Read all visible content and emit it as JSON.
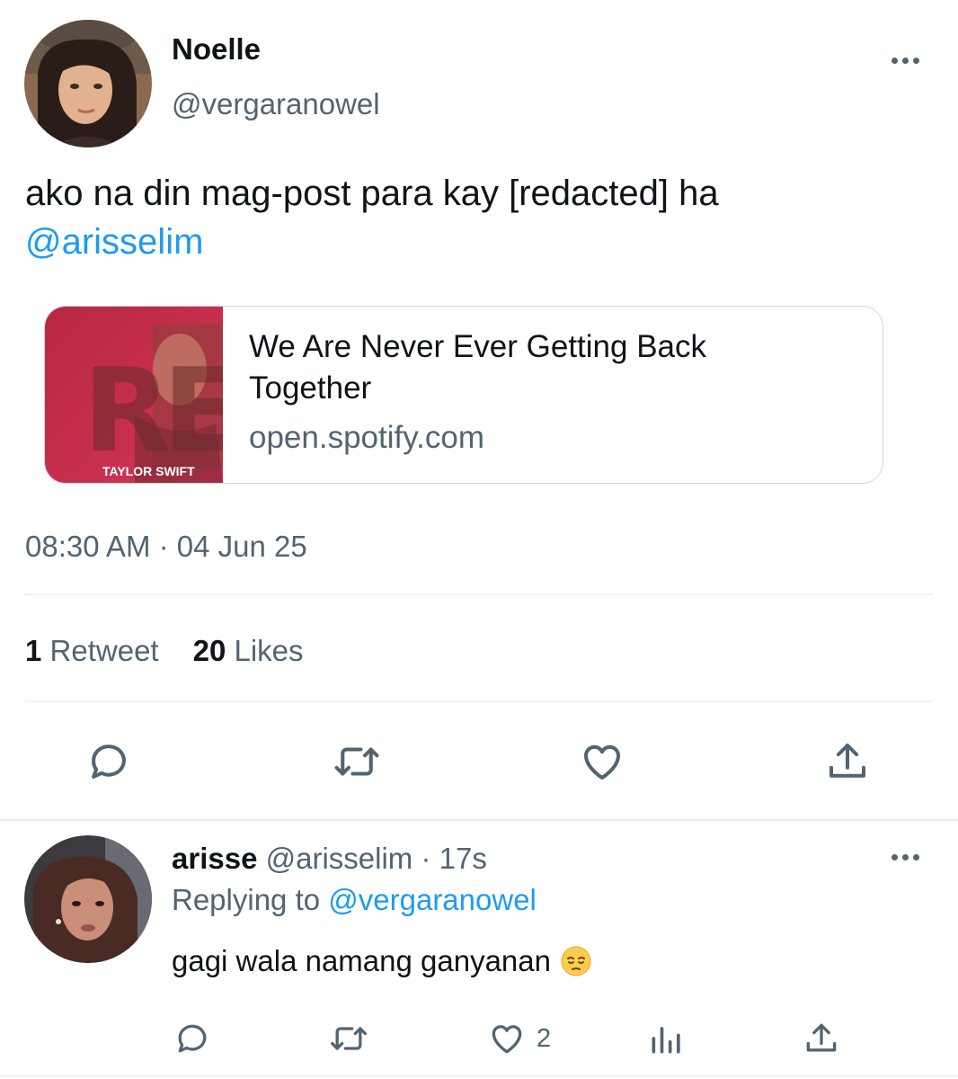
{
  "main_tweet": {
    "author_name": "Noelle",
    "author_handle": "@vergaranowel",
    "text": "ako na din mag-post para kay [redacted] ha ",
    "mention": "@arisselim",
    "link_card": {
      "thumbnail_album_text": "RED",
      "thumbnail_artist_text": "TAYLOR SWIFT",
      "title": "We Are Never Ever Getting Back Together",
      "domain": "open.spotify.com"
    },
    "timestamp": "08:30 AM · 04 Jun 25",
    "retweet_count": "1",
    "retweet_label": "Retweet",
    "like_count": "20",
    "like_label": "Likes",
    "actions": [
      "reply-icon",
      "retweet-icon",
      "like-icon",
      "share-icon"
    ]
  },
  "reply": {
    "author_name": "arisse",
    "author_handle": "@arisselim",
    "time": " · 17s",
    "replying_to_label": "Replying to ",
    "replying_to_handle": "@vergaranowel",
    "text": "gagi wala namang ganyanan",
    "emoji": "pensive-face-emoji",
    "like_count": "2",
    "actions": [
      "reply-icon",
      "retweet-icon",
      "like-icon",
      "analytics-icon",
      "share-icon"
    ]
  },
  "colors": {
    "accent": "#1d9bf0",
    "text_primary": "#0f1419",
    "text_secondary": "#536471",
    "divider": "#eff3f4",
    "card_border": "#cfd9de",
    "album_red": "#c52a4a"
  }
}
